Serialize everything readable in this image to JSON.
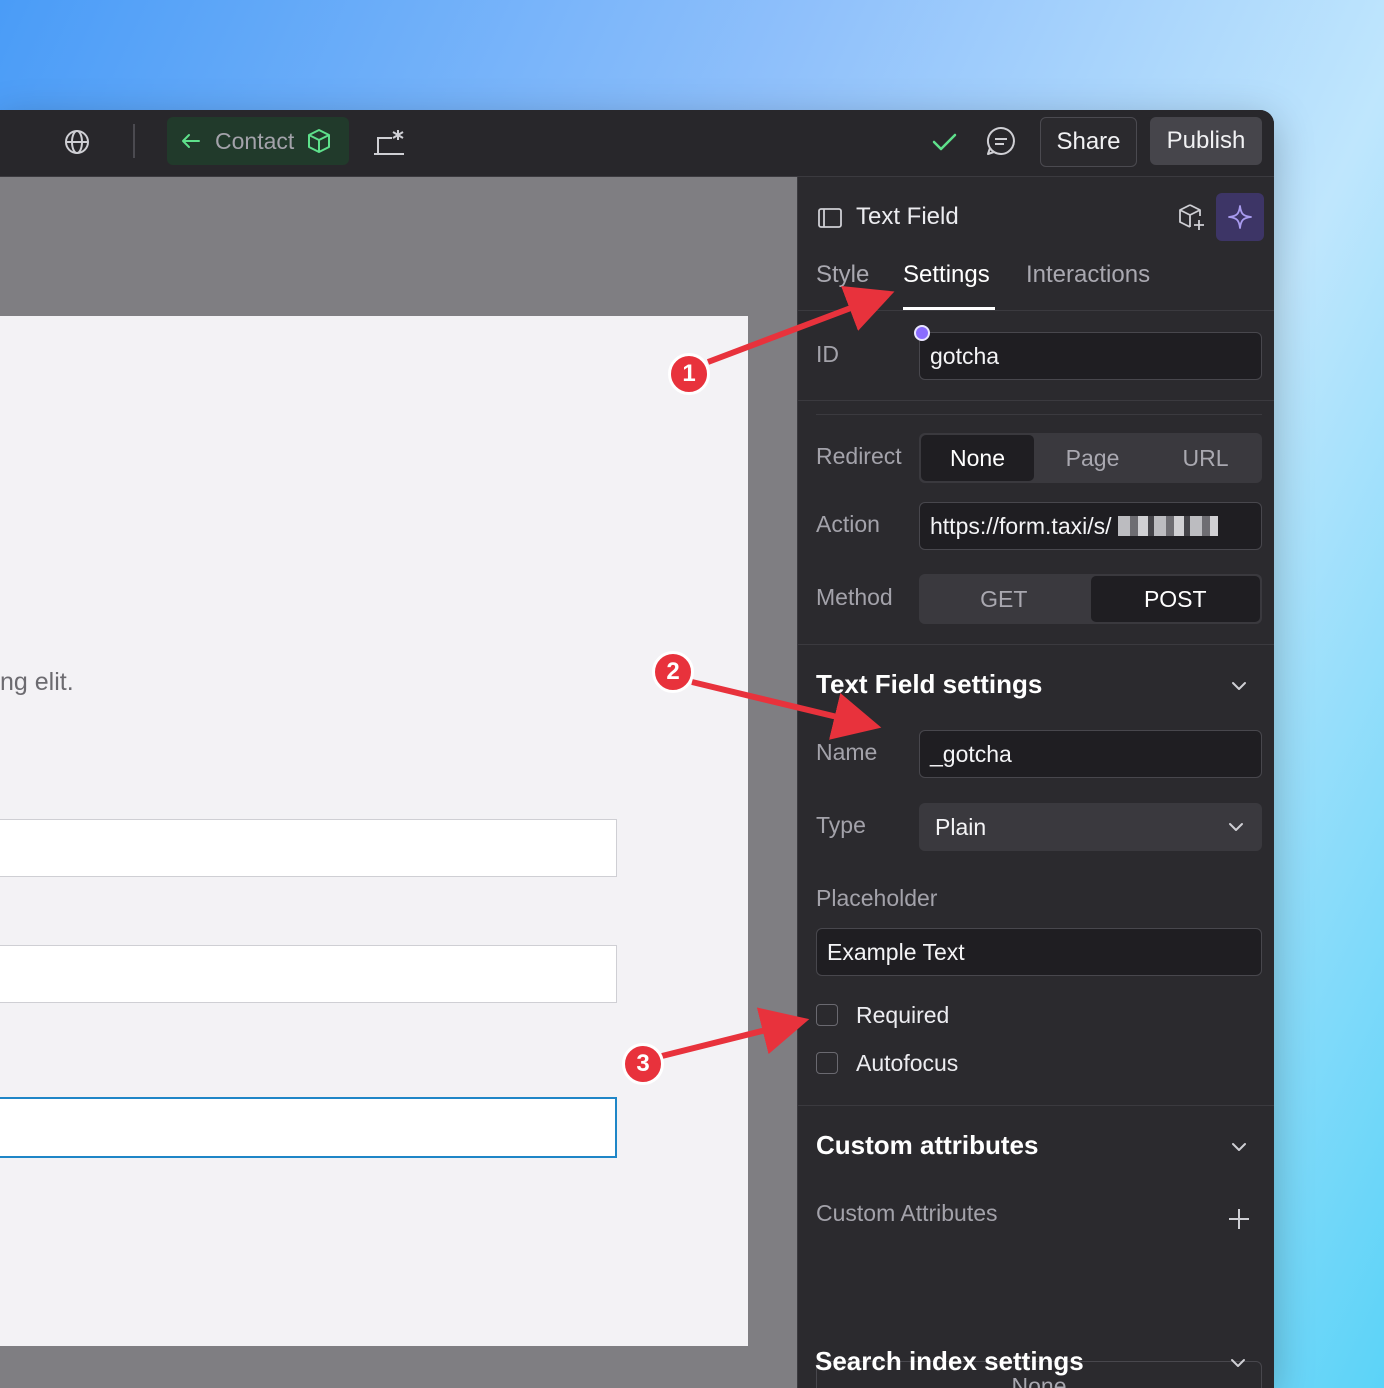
{
  "toolbar": {
    "page_label": "Contact",
    "share_label": "Share",
    "publish_label": "Publish"
  },
  "canvas": {
    "page_text": "ng elit."
  },
  "panel": {
    "element_title": "Text Field",
    "tabs": [
      {
        "label": "Style"
      },
      {
        "label": "Settings"
      },
      {
        "label": "Interactions"
      }
    ],
    "active_tab": "Settings",
    "id_label": "ID",
    "id_value": "gotcha",
    "redirect_label": "Redirect",
    "redirect_options": [
      "None",
      "Page",
      "URL"
    ],
    "redirect_selected": "None",
    "action_label": "Action",
    "action_value": "https://form.taxi/s/",
    "method_label": "Method",
    "method_options": [
      "GET",
      "POST"
    ],
    "method_selected": "POST",
    "text_field_section": {
      "title": "Text Field settings",
      "name_label": "Name",
      "name_value": "_gotcha",
      "type_label": "Type",
      "type_value": "Plain",
      "placeholder_label": "Placeholder",
      "placeholder_value": "Example Text",
      "required_label": "Required",
      "required_checked": false,
      "autofocus_label": "Autofocus",
      "autofocus_checked": false
    },
    "custom_attributes_section": {
      "title": "Custom attributes",
      "list_label": "Custom Attributes",
      "empty_label": "None"
    },
    "search_index_section": {
      "title": "Search index settings"
    }
  },
  "annotations": {
    "badges": [
      "1",
      "2",
      "3"
    ],
    "color": "#e8323c"
  },
  "colors": {
    "accent_green": "#5ee08b",
    "ai_purple": "#3d3566"
  }
}
